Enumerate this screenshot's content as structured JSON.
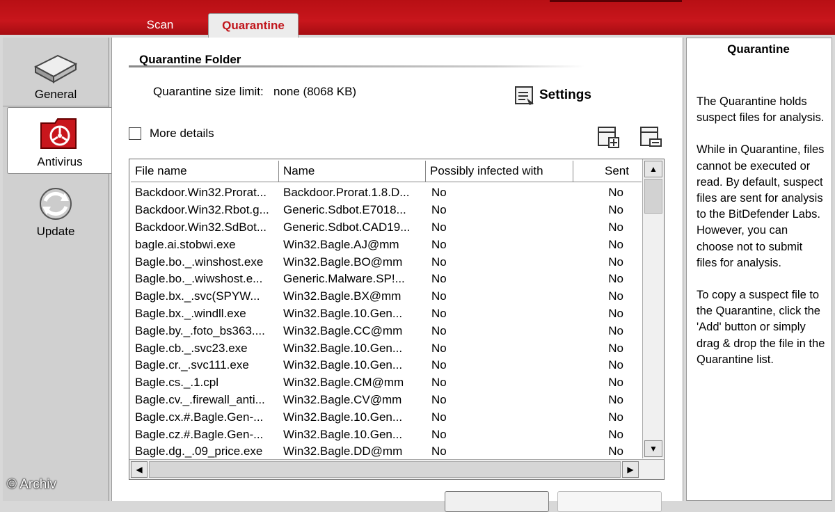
{
  "tabs": {
    "scan": "Scan",
    "quarantine": "Quarantine"
  },
  "sidebar": {
    "general": "General",
    "antivirus": "Antivirus",
    "update": "Update"
  },
  "main": {
    "folder_title": "Quarantine Folder",
    "size_limit_label": "Quarantine size limit:",
    "size_limit_value": "none (8068 KB)",
    "settings_label": "Settings",
    "more_details_label": "More details",
    "more_details_checked": false
  },
  "table": {
    "columns": [
      "File name",
      "Name",
      "Possibly infected with",
      "Sent"
    ],
    "rows": [
      [
        "Backdoor.Win32.Prorat...",
        "Backdoor.Prorat.1.8.D...",
        "No",
        "No"
      ],
      [
        "Backdoor.Win32.Rbot.g...",
        "Generic.Sdbot.E7018...",
        "No",
        "No"
      ],
      [
        "Backdoor.Win32.SdBot...",
        "Generic.Sdbot.CAD19...",
        "No",
        "No"
      ],
      [
        "bagle.ai.stobwi.exe",
        "Win32.Bagle.AJ@mm",
        "No",
        "No"
      ],
      [
        "Bagle.bo._.winshost.exe",
        "Win32.Bagle.BO@mm",
        "No",
        "No"
      ],
      [
        "Bagle.bo._.wiwshost.e...",
        "Generic.Malware.SP!...",
        "No",
        "No"
      ],
      [
        "Bagle.bx._.svc(SPYW...",
        "Win32.Bagle.BX@mm",
        "No",
        "No"
      ],
      [
        "Bagle.bx._.windll.exe",
        "Win32.Bagle.10.Gen...",
        "No",
        "No"
      ],
      [
        "Bagle.by._.foto_bs363....",
        "Win32.Bagle.CC@mm",
        "No",
        "No"
      ],
      [
        "Bagle.cb._.svc23.exe",
        "Win32.Bagle.10.Gen...",
        "No",
        "No"
      ],
      [
        "Bagle.cr._.svc111.exe",
        "Win32.Bagle.10.Gen...",
        "No",
        "No"
      ],
      [
        "Bagle.cs._.1.cpl",
        "Win32.Bagle.CM@mm",
        "No",
        "No"
      ],
      [
        "Bagle.cv._.firewall_anti...",
        "Win32.Bagle.CV@mm",
        "No",
        "No"
      ],
      [
        "Bagle.cx.#.Bagle.Gen-...",
        "Win32.Bagle.10.Gen...",
        "No",
        "No"
      ],
      [
        "Bagle.cz.#.Bagle.Gen-...",
        "Win32.Bagle.10.Gen...",
        "No",
        "No"
      ],
      [
        "Bagle.dg._.09_price.exe",
        "Win32.Bagle.DD@mm",
        "No",
        "No"
      ]
    ]
  },
  "help": {
    "title": "Quarantine",
    "paragraphs": [
      "The Quarantine holds suspect files for analysis.",
      "While in Quarantine, files cannot be executed or read. By default, suspect files are sent for analysis to the BitDefender Labs. However, you can choose not to submit files for analysis.",
      "To copy a suspect file to the Quarantine, click the 'Add' button or simply drag & drop the file in the Quarantine list."
    ]
  },
  "watermark": "© Archiv",
  "colors": {
    "brand_red": "#c8161c",
    "tab_active_text": "#c0141a"
  }
}
